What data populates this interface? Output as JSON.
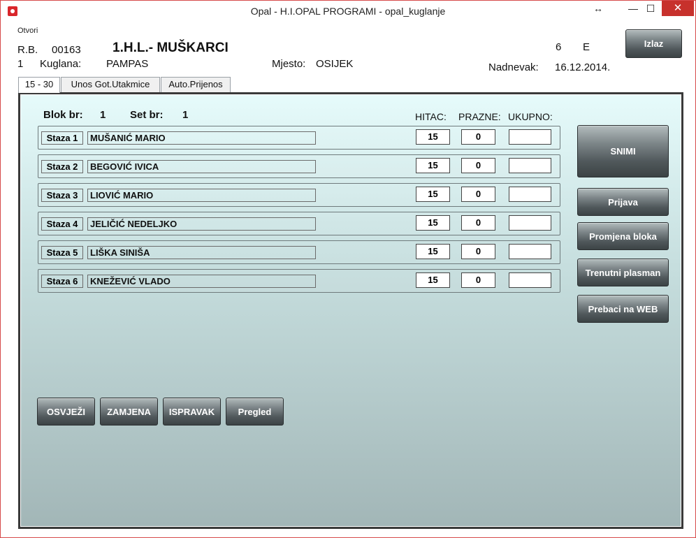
{
  "window": {
    "title": "Opal - H.I.OPAL PROGRAMI - opal_kuglanje",
    "resize_glyph": "↔",
    "min_glyph": "—",
    "max_glyph": "☐",
    "close_glyph": "✕"
  },
  "menu": {
    "otvori": "Otvori"
  },
  "header": {
    "rb_label": "R.B.",
    "rb_value": "00163",
    "league": "1.H.L.- MUŠKARCI",
    "num_left": "1",
    "kuglana_label": "Kuglana:",
    "kuglana_value": "PAMPAS",
    "mjesto_label": "Mjesto:",
    "mjesto_value": "OSIJEK",
    "six": "6",
    "e": "E",
    "nadnevak_label": "Nadnevak:",
    "nadnevak_value": "16.12.2014.",
    "izlaz_label": "Izlaz"
  },
  "tabs": [
    {
      "label": "15 - 30"
    },
    {
      "label": "Unos Got.Utakmice"
    },
    {
      "label": "Auto.Prijenos"
    }
  ],
  "panel": {
    "blok_label": "Blok br:",
    "blok_value": "1",
    "set_label": "Set br:",
    "set_value": "1",
    "col_hitac": "HITAC:",
    "col_prazne": "PRAZNE:",
    "col_ukupno": "UKUPNO:"
  },
  "rows": [
    {
      "staza": "Staza 1",
      "name": "MUŠANIĆ MARIO",
      "hitac": "15",
      "prazne": "0",
      "ukupno": ""
    },
    {
      "staza": "Staza 2",
      "name": "BEGOVIĆ IVICA",
      "hitac": "15",
      "prazne": "0",
      "ukupno": ""
    },
    {
      "staza": "Staza 3",
      "name": "LIOVIĆ MARIO",
      "hitac": "15",
      "prazne": "0",
      "ukupno": ""
    },
    {
      "staza": "Staza 4",
      "name": "JELIČIĆ NEDELJKO",
      "hitac": "15",
      "prazne": "0",
      "ukupno": ""
    },
    {
      "staza": "Staza 5",
      "name": "LIŠKA SINIŠA",
      "hitac": "15",
      "prazne": "0",
      "ukupno": ""
    },
    {
      "staza": "Staza 6",
      "name": "KNEŽEVIĆ VLADO",
      "hitac": "15",
      "prazne": "0",
      "ukupno": ""
    }
  ],
  "side_buttons": {
    "snimi": "SNIMI",
    "prijava": "Prijava",
    "promjena": "Promjena bloka",
    "plasman": "Trenutni plasman",
    "web": "Prebaci na WEB"
  },
  "bottom_buttons": {
    "osvjezi": "OSVJEŽI",
    "zamjena": "ZAMJENA",
    "ispravak": "ISPRAVAK",
    "pregled": "Pregled"
  }
}
